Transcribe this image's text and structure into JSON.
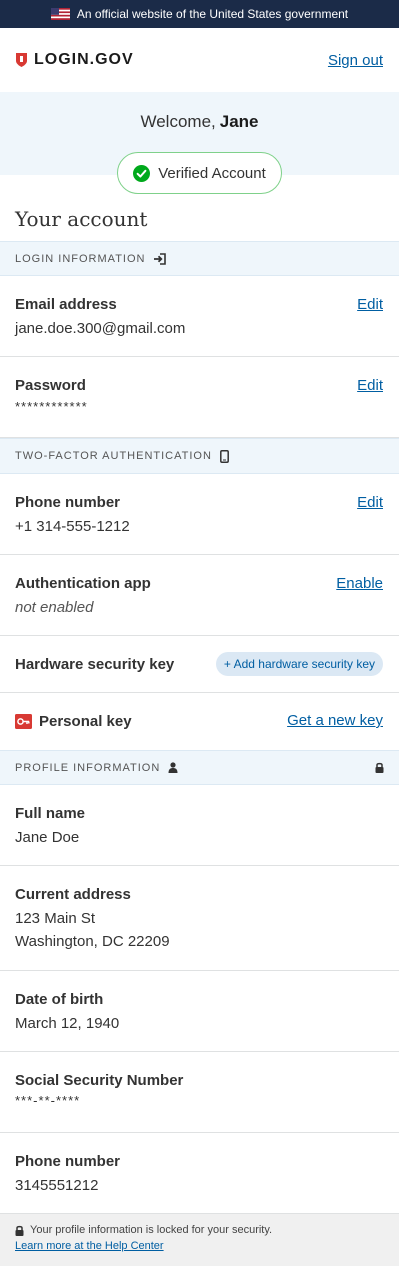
{
  "banner": {
    "text": "An official website of the United States government"
  },
  "header": {
    "logo_text": "LOGIN.GOV",
    "signout": "Sign out"
  },
  "welcome": {
    "prefix": "Welcome,",
    "name": "Jane"
  },
  "verified": {
    "label": "Verified Account"
  },
  "page_title": "Your account",
  "login_info": {
    "heading": "LOGIN INFORMATION",
    "email": {
      "label": "Email address",
      "value": "jane.doe.300@gmail.com",
      "action": "Edit"
    },
    "password": {
      "label": "Password",
      "value": "************",
      "action": "Edit"
    }
  },
  "two_factor": {
    "heading": "TWO-FACTOR AUTHENTICATION",
    "phone": {
      "label": "Phone number",
      "value": "+1 314-555-1212",
      "action": "Edit"
    },
    "auth_app": {
      "label": "Authentication app",
      "value": "not enabled",
      "action": "Enable"
    },
    "hardware_key": {
      "label": "Hardware security key",
      "action": "+ Add hardware security key"
    },
    "personal_key": {
      "label": "Personal key",
      "action": "Get a new key"
    }
  },
  "profile": {
    "heading": "PROFILE INFORMATION",
    "full_name": {
      "label": "Full name",
      "value": "Jane Doe"
    },
    "address": {
      "label": "Current address",
      "line1": "123 Main St",
      "line2": "Washington, DC 22209"
    },
    "dob": {
      "label": "Date of birth",
      "value": "March 12, 1940"
    },
    "ssn": {
      "label": "Social Security Number",
      "value": "***-**-****"
    },
    "phone": {
      "label": "Phone number",
      "value": "3145551212"
    }
  },
  "footer": {
    "locked_text": "Your profile information is locked for your security.",
    "help_link": "Learn more at the Help Center"
  },
  "colors": {
    "navy": "#1b2b48",
    "link": "#005ea2",
    "light_blue": "#eff6fb",
    "verified_green": "#00a91c",
    "key_red": "#d83933"
  }
}
